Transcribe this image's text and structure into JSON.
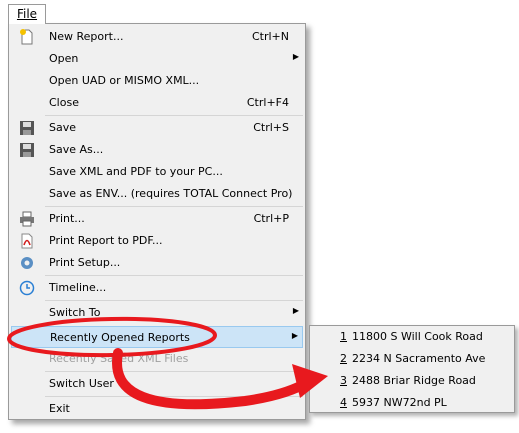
{
  "menubar": {
    "file_label": "File"
  },
  "menu": {
    "items": [
      {
        "label": "New Report...",
        "shortcut": "Ctrl+N",
        "icon": "new-report-icon"
      },
      {
        "label": "Open",
        "submenu": true
      },
      {
        "label": "Open UAD or MISMO XML..."
      },
      {
        "label": "Close",
        "shortcut": "Ctrl+F4"
      },
      {
        "label": "Save",
        "shortcut": "Ctrl+S",
        "icon": "floppy-disk-icon"
      },
      {
        "label": "Save As...",
        "icon": "floppy-disk-icon"
      },
      {
        "label": "Save XML and PDF to your PC..."
      },
      {
        "label": "Save as ENV... (requires TOTAL Connect Pro)"
      },
      {
        "label": "Print...",
        "shortcut": "Ctrl+P",
        "icon": "printer-icon"
      },
      {
        "label": "Print Report to PDF...",
        "icon": "pdf-icon"
      },
      {
        "label": "Print Setup...",
        "icon": "gear-icon"
      },
      {
        "label": "Timeline...",
        "icon": "clock-icon"
      },
      {
        "label": "Switch To",
        "submenu": true
      },
      {
        "label": "Recently Opened Reports",
        "submenu": true,
        "highlighted": true
      },
      {
        "label": "Recently Saved XML Files",
        "disabled": true
      },
      {
        "label": "Switch User"
      },
      {
        "label": "Exit"
      }
    ]
  },
  "recent_reports": [
    {
      "num": "1",
      "address": "11800 S Will Cook Road"
    },
    {
      "num": "2",
      "address": "2234 N Sacramento Ave"
    },
    {
      "num": "3",
      "address": "2488 Briar Ridge Road"
    },
    {
      "num": "4",
      "address": "5937 NW72nd PL"
    }
  ],
  "colors": {
    "highlight": "#cce4f7",
    "annotation": "#e8191e"
  }
}
